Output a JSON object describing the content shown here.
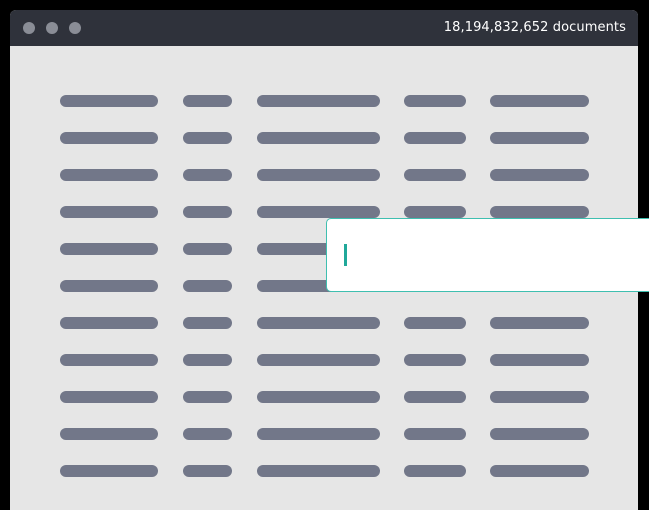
{
  "window": {
    "document_count": "18,194,832,652 documents",
    "controls": [
      "close",
      "minimize",
      "zoom"
    ]
  },
  "search": {
    "value": "",
    "placeholder": ""
  },
  "result_table": {
    "columns": 5,
    "rows": 11,
    "content": "placeholder bars (no readable text)"
  },
  "colors": {
    "titlebar": "#2f323b",
    "window_background": "#e6e6e6",
    "placeholder_bar": "#727789",
    "search_border": "#3fbfb0",
    "caret": "#20a89a"
  },
  "icons": [
    "window-close-dot",
    "window-minimize-dot",
    "window-zoom-dot"
  ]
}
